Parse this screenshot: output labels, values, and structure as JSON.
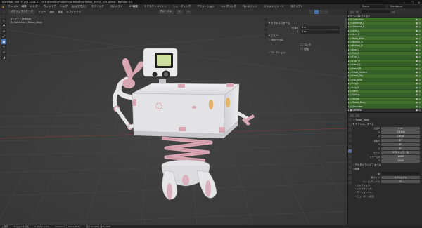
{
  "window": {
    "title": "turtlebot_0001P_v01 2024-01-15 E:\\Blender\\Projects\\turtlebot\\turtlebot_0001P_v01.blend - Blender 4.0",
    "controls": [
      "–",
      "□",
      "×"
    ]
  },
  "menubar": {
    "items": [
      "ファイル",
      "編集",
      "レンダー",
      "ウィンドウ",
      "ヘルプ"
    ],
    "workspaces": [
      "レイアウト",
      "モデリング",
      "スカルプト",
      "UV編集",
      "テクスチャペイント",
      "シェーディング",
      "アニメーション",
      "レンダリング",
      "コンポジット",
      "ジオメトリノード",
      "スクリプト"
    ],
    "active_workspace": "レイアウト",
    "scene": "Scene",
    "view_layer": "ViewLayer"
  },
  "viewport_header": {
    "mode": "オブジェクトモード",
    "menus": [
      "ビュー",
      "選択",
      "追加",
      "オブジェクト"
    ],
    "transform_orientation": "グローバル",
    "pivot": "⊙",
    "snap": "⌗"
  },
  "viewport_overlay": {
    "view_name": "ユーザー・透視投影",
    "collection_line": "(1) Collection | Robot_Body"
  },
  "npanel": {
    "section1": "▾ トランスフォーム",
    "rows": [
      {
        "label": "位置X",
        "value": "0 m"
      },
      {
        "label": "Y",
        "value": "0 m"
      }
    ],
    "section2": "▾ ビュー",
    "section3": "› 3Dカーソル",
    "checkboxes": [
      "ロック",
      "回転"
    ],
    "section4": "› コレクション"
  },
  "toolbar": {
    "tools": [
      "↖",
      "✥",
      "⟳",
      "⤢",
      "▣",
      "✎",
      "⚲",
      "◢"
    ],
    "active_index": 4
  },
  "outliner": {
    "rows": [
      {
        "name": "▾ シーンコレクション",
        "state": "plain",
        "vis": ""
      },
      {
        "name": "▾ ☑ Collection",
        "state": "sel",
        "vis": "◉ ◎"
      },
      {
        "name": "  ▸ ▽ Antenna_L",
        "state": "sel",
        "vis": "◉ ◎"
      },
      {
        "name": "  ▸ ▽ Antenna_R",
        "state": "sel2",
        "vis": "◉ ◎"
      },
      {
        "name": "  ▸ ▽ Arm_L",
        "state": "sel",
        "vis": "◉ ◎"
      },
      {
        "name": "  ▸ ▽ Arm_R",
        "state": "sel2",
        "vis": "◉ ◎"
      },
      {
        "name": "  ▸ ▽ Body_Main",
        "state": "sel",
        "vis": "◉ ◎"
      },
      {
        "name": "  ▸ ▽ Button_A",
        "state": "sel2",
        "vis": "◉ ◎"
      },
      {
        "name": "  ▸ ▽ Button_B",
        "state": "sel",
        "vis": "◉ ◎"
      },
      {
        "name": "  ▸ ▽ Eye_L",
        "state": "sel2",
        "vis": "◉ ◎"
      },
      {
        "name": "  ▸ ▽ Eye_R",
        "state": "sel",
        "vis": "◉ ◎"
      },
      {
        "name": "  ▸ ▽ Foot_L",
        "state": "sel2",
        "vis": "◉ ◎"
      },
      {
        "name": "  ▸ ▽ Foot_R",
        "state": "sel",
        "vis": "◉ ◎"
      },
      {
        "name": "  ▸ ▽ Hand_L",
        "state": "sel2",
        "vis": "◉ ◎"
      },
      {
        "name": "  ▸ ▽ Hand_R",
        "state": "sel",
        "vis": "◉ ◎"
      },
      {
        "name": "  ▸ ▽ Head_Screen",
        "state": "sel2",
        "vis": "◉ ◎"
      },
      {
        "name": "  ▸ ▽ Head_Top",
        "state": "sel",
        "vis": "◉ ◎"
      },
      {
        "name": "  ▸ ▽ Hip_Joint",
        "state": "sel2",
        "vis": "◉ ◎"
      },
      {
        "name": "  ▸ ▽ Leg_L",
        "state": "sel",
        "vis": "◉ ◎"
      },
      {
        "name": "  ▸ ▽ Leg_R",
        "state": "sel2",
        "vis": "◉ ◎"
      },
      {
        "name": "  ▸ ▽ Neck",
        "state": "sel",
        "vis": "◉ ◎"
      },
      {
        "name": "  ▸ ▽ Spring",
        "state": "sel2",
        "vis": "◉ ◎"
      },
      {
        "name": "  ▸ ▽ Wheel",
        "state": "sel",
        "vis": "◉ ◎"
      },
      {
        "name": "  ▸ ▽ Robot_Body",
        "state": "sel",
        "vis": "◉ ◎"
      },
      {
        "name": "  ▸ ▽ Shoulder",
        "state": "sel2",
        "vis": "◉ ◎"
      },
      {
        "name": "  ▸ ◉ Camera",
        "state": "plain",
        "vis": "◉ ◎"
      },
      {
        "name": "  ▸ ☀ Light",
        "state": "plain",
        "vis": "◉ ◎"
      }
    ]
  },
  "properties": {
    "breadcrumb": "▽ Robot_Body",
    "subbread": "▾ トランスフォーム",
    "rows": [
      {
        "label": "位置X",
        "value": "0 m"
      },
      {
        "label": "Y",
        "value": "-0.12 m"
      },
      {
        "label": "Z",
        "value": "1.35 m"
      },
      {
        "label": "回転X",
        "value": "0°"
      },
      {
        "label": "Y",
        "value": "0°"
      },
      {
        "label": "Z",
        "value": "0°"
      },
      {
        "label": "モード",
        "value": "XYZ オイラー角"
      },
      {
        "label": "スケールX",
        "value": "1.000"
      },
      {
        "label": "Y",
        "value": "1.000"
      }
    ],
    "section_relations": "› デルタトランスフォーム",
    "section_collections": "› 関係",
    "parent_label": "親",
    "parent_value": "",
    "parent_type_label": "親タイプ",
    "parent_type_value": "オブジェクト",
    "pass_index_label": "パスインデックス",
    "pass_index_value": "0",
    "checks": [
      "› コレクション",
      "› インスタンス化",
      "› モーションパス",
      "› ビューポート表示"
    ]
  },
  "bottombar": {
    "items": [
      "▸ 選択",
      "⟲ ビューを回転",
      "≡ オブジェクト",
      "Collection | Robot_Body",
      "頂点:12,480 | 面:11,920"
    ]
  },
  "colors": {
    "accent": "#4772b3",
    "outliner_selected": "#3f6e2b",
    "robot_white": "#e8e8ea",
    "robot_pink": "#d9a6b4",
    "viewport_bg": "#3b3b3b"
  }
}
